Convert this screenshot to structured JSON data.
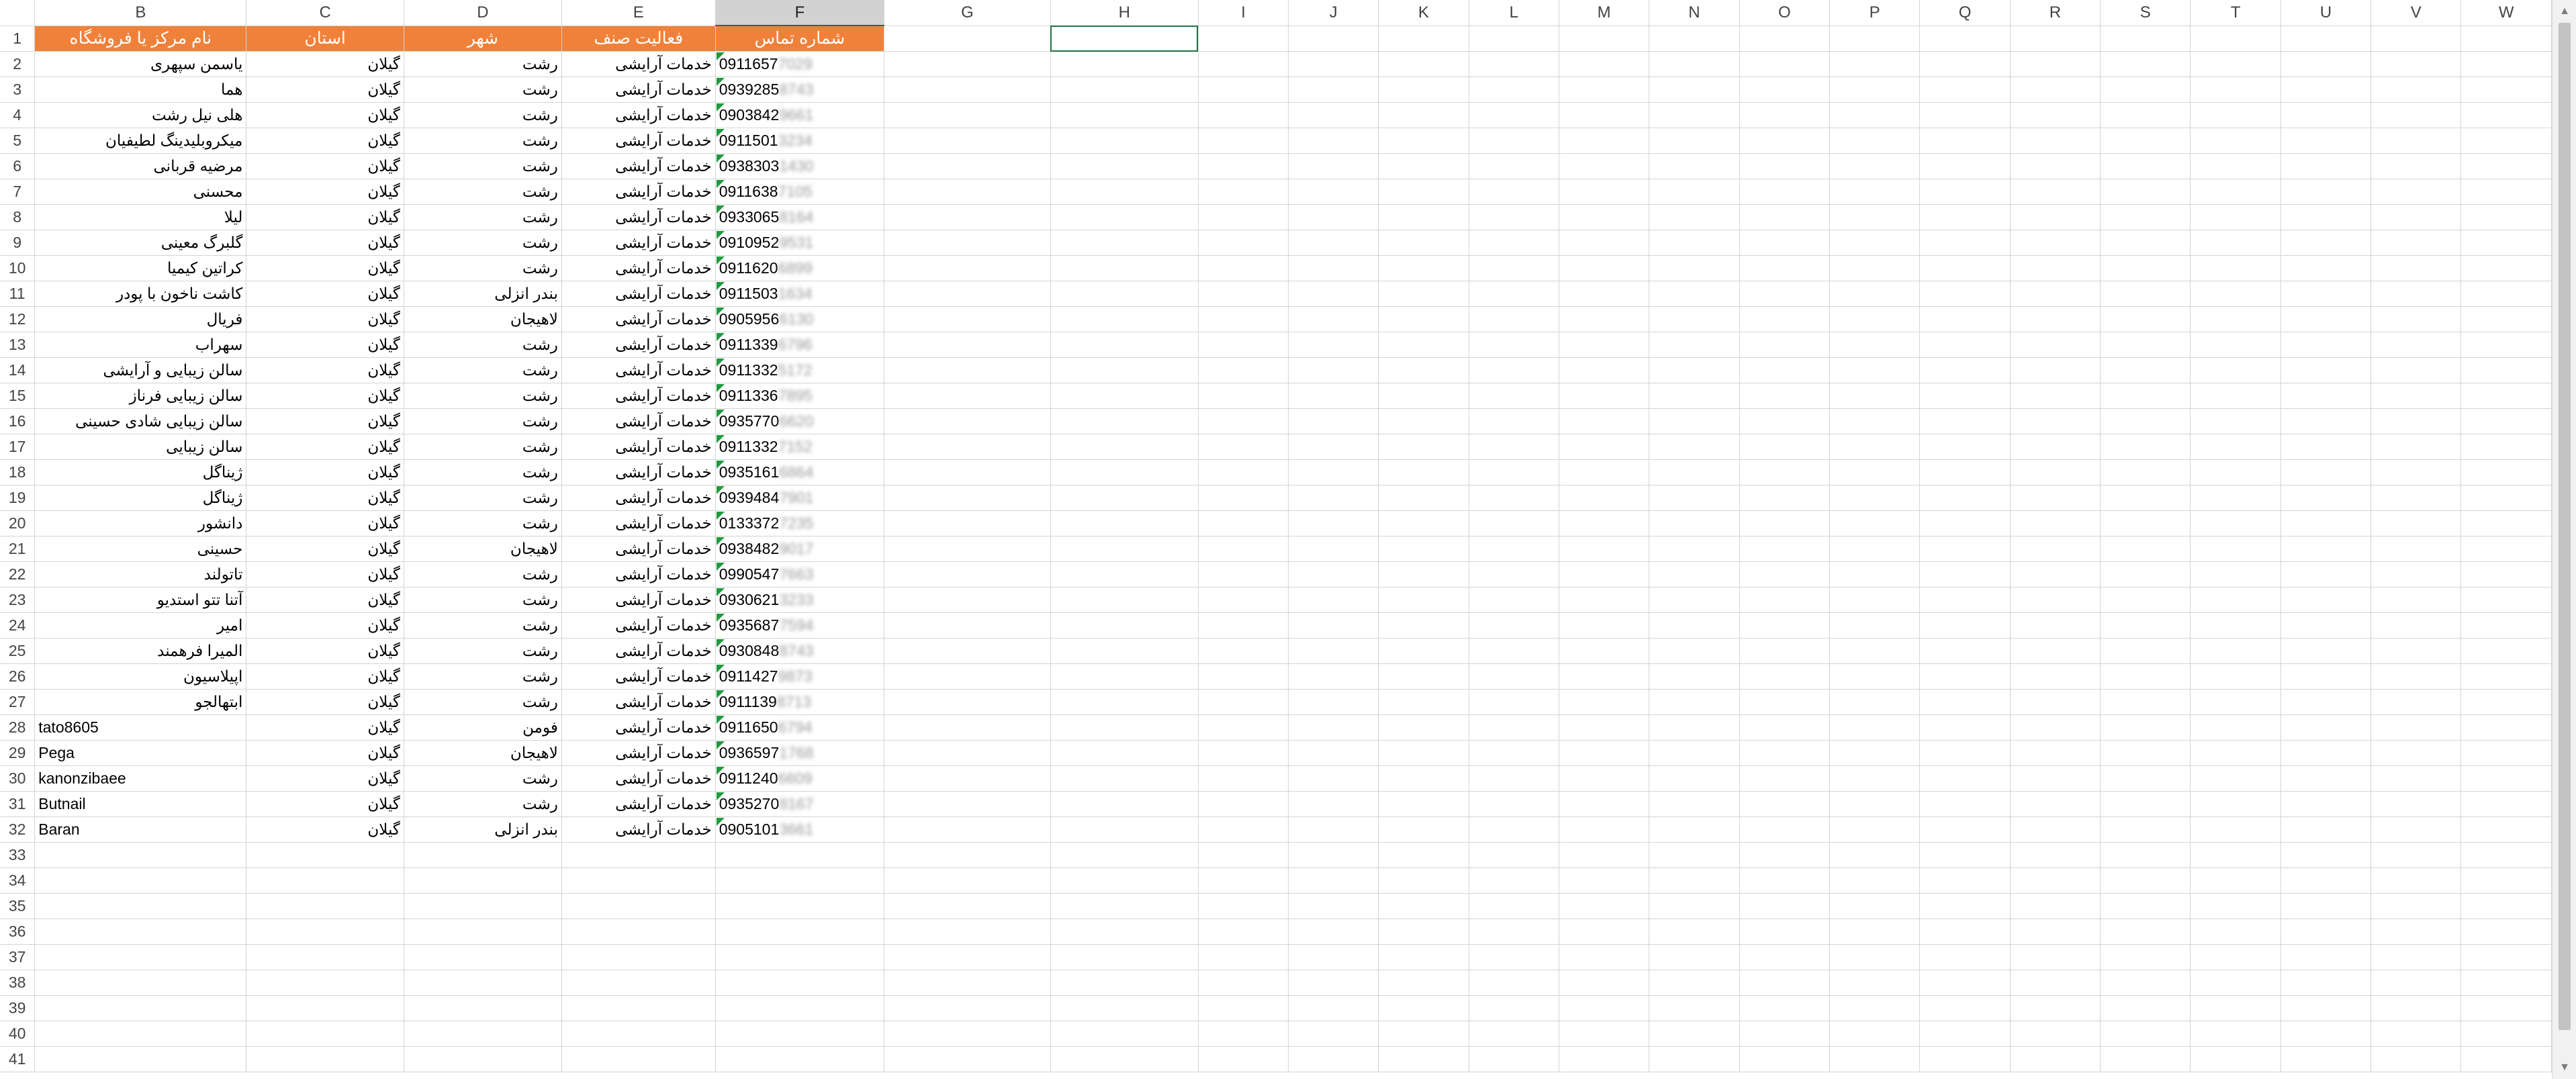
{
  "columns": [
    "B",
    "C",
    "D",
    "E",
    "F",
    "G",
    "H",
    "I",
    "J",
    "K",
    "L",
    "M",
    "N",
    "O",
    "P",
    "Q",
    "R",
    "S",
    "T",
    "U",
    "V",
    "W"
  ],
  "selected_column": "F",
  "header_row": {
    "row": "1",
    "cells": [
      "نام مرکز یا فروشگاه",
      "استان",
      "شهر",
      "فعالیت صنف",
      "شماره تماس"
    ]
  },
  "rows": [
    {
      "n": "2",
      "name": "یاسمن سپهری",
      "province": "گیلان",
      "city": "رشت",
      "activity": "خدمات آرایشی",
      "phone": "0911657",
      "hidden": "7029"
    },
    {
      "n": "3",
      "name": "هما",
      "province": "گیلان",
      "city": "رشت",
      "activity": "خدمات آرایشی",
      "phone": "0939285",
      "hidden": "8743"
    },
    {
      "n": "4",
      "name": "هلی نیل رشت",
      "province": "گیلان",
      "city": "رشت",
      "activity": "خدمات آرایشی",
      "phone": "0903842",
      "hidden": "9661"
    },
    {
      "n": "5",
      "name": "میکروبلیدینگ لطیفیان",
      "province": "گیلان",
      "city": "رشت",
      "activity": "خدمات آرایشی",
      "phone": "0911501",
      "hidden": "3234"
    },
    {
      "n": "6",
      "name": "مرضیه قربانی",
      "province": "گیلان",
      "city": "رشت",
      "activity": "خدمات آرایشی",
      "phone": "0938303",
      "hidden": "1430"
    },
    {
      "n": "7",
      "name": "محسنی",
      "province": "گیلان",
      "city": "رشت",
      "activity": "خدمات آرایشی",
      "phone": "0911638",
      "hidden": "7105"
    },
    {
      "n": "8",
      "name": "لیلا",
      "province": "گیلان",
      "city": "رشت",
      "activity": "خدمات آرایشی",
      "phone": "0933065",
      "hidden": "8164"
    },
    {
      "n": "9",
      "name": "گلبرگ معینی",
      "province": "گیلان",
      "city": "رشت",
      "activity": "خدمات آرایشی",
      "phone": "0910952",
      "hidden": "9531"
    },
    {
      "n": "10",
      "name": "کراتین کیمیا",
      "province": "گیلان",
      "city": "رشت",
      "activity": "خدمات آرایشی",
      "phone": "0911620",
      "hidden": "6899"
    },
    {
      "n": "11",
      "name": "کاشت ناخون با پودر",
      "province": "گیلان",
      "city": "بندر انزلی",
      "activity": "خدمات آرایشی",
      "phone": "0911503",
      "hidden": "1634"
    },
    {
      "n": "12",
      "name": "فریال",
      "province": "گیلان",
      "city": "لاهیجان",
      "activity": "خدمات آرایشی",
      "phone": "0905956",
      "hidden": "6130"
    },
    {
      "n": "13",
      "name": "سهراب",
      "province": "گیلان",
      "city": "رشت",
      "activity": "خدمات آرایشی",
      "phone": "0911339",
      "hidden": "6796"
    },
    {
      "n": "14",
      "name": "سالن زیبایی و آرایشی",
      "province": "گیلان",
      "city": "رشت",
      "activity": "خدمات آرایشی",
      "phone": "0911332",
      "hidden": "5172"
    },
    {
      "n": "15",
      "name": "سالن زیبایی فرناز",
      "province": "گیلان",
      "city": "رشت",
      "activity": "خدمات آرایشی",
      "phone": "0911336",
      "hidden": "7895"
    },
    {
      "n": "16",
      "name": "سالن زیبایی شادی حسینی",
      "province": "گیلان",
      "city": "رشت",
      "activity": "خدمات آرایشی",
      "phone": "0935770",
      "hidden": "6620"
    },
    {
      "n": "17",
      "name": "سالن زیبایی",
      "province": "گیلان",
      "city": "رشت",
      "activity": "خدمات آرایشی",
      "phone": "0911332",
      "hidden": "7152"
    },
    {
      "n": "18",
      "name": "ژیناگل",
      "province": "گیلان",
      "city": "رشت",
      "activity": "خدمات آرایشی",
      "phone": "0935161",
      "hidden": "6864"
    },
    {
      "n": "19",
      "name": "ژیناگل",
      "province": "گیلان",
      "city": "رشت",
      "activity": "خدمات آرایشی",
      "phone": "0939484",
      "hidden": "7901"
    },
    {
      "n": "20",
      "name": "دانشور",
      "province": "گیلان",
      "city": "رشت",
      "activity": "خدمات آرایشی",
      "phone": "0133372",
      "hidden": "7235"
    },
    {
      "n": "21",
      "name": "حسینی",
      "province": "گیلان",
      "city": "لاهیجان",
      "activity": "خدمات آرایشی",
      "phone": "0938482",
      "hidden": "9017"
    },
    {
      "n": "22",
      "name": "تاتولند",
      "province": "گیلان",
      "city": "رشت",
      "activity": "خدمات آرایشی",
      "phone": "0990547",
      "hidden": "7663"
    },
    {
      "n": "23",
      "name": "آتنا تتو استدیو",
      "province": "گیلان",
      "city": "رشت",
      "activity": "خدمات آرایشی",
      "phone": "0930621",
      "hidden": "3233"
    },
    {
      "n": "24",
      "name": "امیر",
      "province": "گیلان",
      "city": "رشت",
      "activity": "خدمات آرایشی",
      "phone": "0935687",
      "hidden": "7594"
    },
    {
      "n": "25",
      "name": "المیرا فرهمند",
      "province": "گیلان",
      "city": "رشت",
      "activity": "خدمات آرایشی",
      "phone": "0930848",
      "hidden": "8743"
    },
    {
      "n": "26",
      "name": "اپیلاسیون",
      "province": "گیلان",
      "city": "رشت",
      "activity": "خدمات آرایشی",
      "phone": "0911427",
      "hidden": "9873"
    },
    {
      "n": "27",
      "name": "ابتهالجو",
      "province": "گیلان",
      "city": "رشت",
      "activity": "خدمات آرایشی",
      "phone": "0911139",
      "hidden": "8713"
    },
    {
      "n": "28",
      "name": "tato8605",
      "province": "گیلان",
      "city": "فومن",
      "activity": "خدمات آرایشی",
      "phone": "0911650",
      "hidden": "6794"
    },
    {
      "n": "29",
      "name": "Pega",
      "province": "گیلان",
      "city": "لاهیجان",
      "activity": "خدمات آرایشی",
      "phone": "0936597",
      "hidden": "1768"
    },
    {
      "n": "30",
      "name": "kanonzibaee",
      "province": "گیلان",
      "city": "رشت",
      "activity": "خدمات آرایشی",
      "phone": "0911240",
      "hidden": "6609"
    },
    {
      "n": "31",
      "name": "Butnail",
      "province": "گیلان",
      "city": "رشت",
      "activity": "خدمات آرایشی",
      "phone": "0935270",
      "hidden": "8167"
    },
    {
      "n": "32",
      "name": "Baran",
      "province": "گیلان",
      "city": "بندر انزلی",
      "activity": "خدمات آرایشی",
      "phone": "0905101",
      "hidden": "3661"
    }
  ],
  "empty_rows": [
    "33",
    "34",
    "35",
    "36",
    "37",
    "38",
    "39",
    "40",
    "41"
  ]
}
